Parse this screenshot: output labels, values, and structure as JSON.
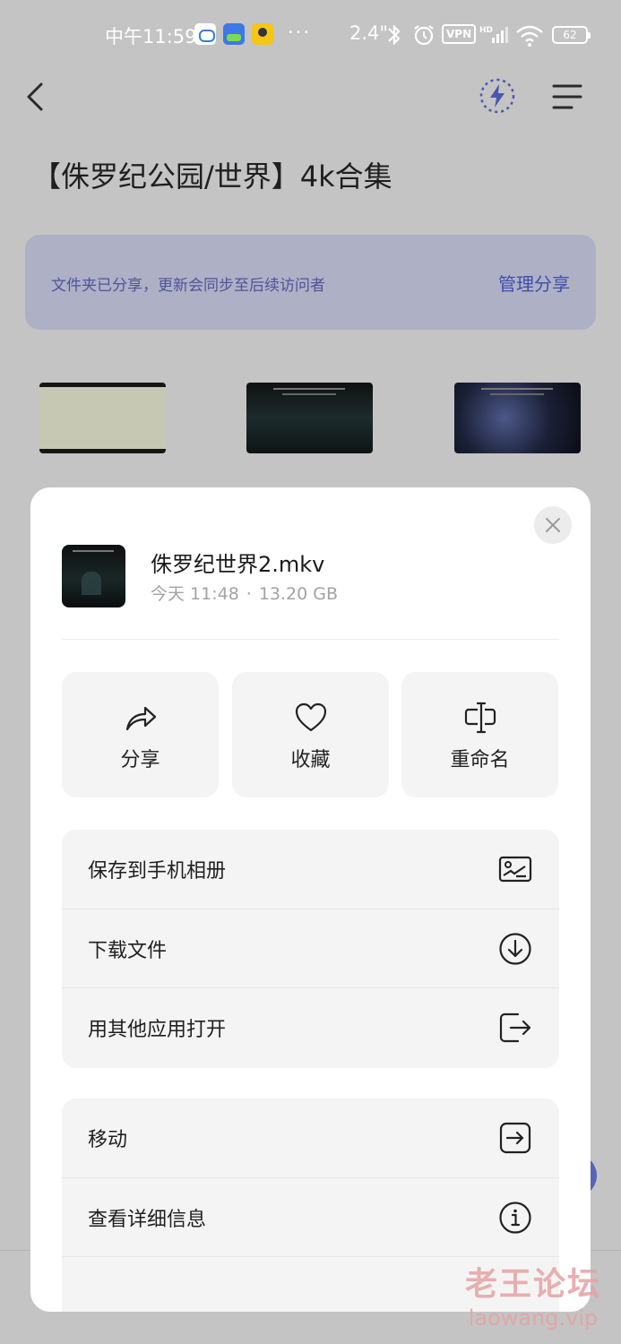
{
  "status_bar": {
    "time": "中午11:59",
    "dots": "···",
    "net_speed": "2.4\"",
    "vpn_label": "VPN",
    "battery": "62"
  },
  "nav": {
    "back_icon": "chevron-left-icon",
    "bolt_icon": "lightning-icon",
    "menu_icon": "hamburger-menu-icon"
  },
  "folder": {
    "title": "【侏罗纪公园/世界】4k合集",
    "banner_text": "文件夹已分享，更新会同步至后续访问者",
    "banner_link": "管理分享"
  },
  "sheet": {
    "file_name": "侏罗纪世界2.mkv",
    "file_date": "今天 11:48",
    "file_sep": "·",
    "file_size": "13.20 GB",
    "actions": [
      {
        "label": "分享",
        "icon": "share-icon"
      },
      {
        "label": "收藏",
        "icon": "heart-icon"
      },
      {
        "label": "重命名",
        "icon": "rename-icon"
      }
    ],
    "menu_group_1": [
      {
        "label": "保存到手机相册",
        "icon": "image-icon"
      },
      {
        "label": "下载文件",
        "icon": "download-icon"
      },
      {
        "label": "用其他应用打开",
        "icon": "open-external-icon"
      }
    ],
    "menu_group_2": [
      {
        "label": "移动",
        "icon": "move-icon"
      },
      {
        "label": "查看详细信息",
        "icon": "info-icon"
      }
    ]
  },
  "watermark": {
    "cn": "老王论坛",
    "url": "laowang.vip"
  }
}
